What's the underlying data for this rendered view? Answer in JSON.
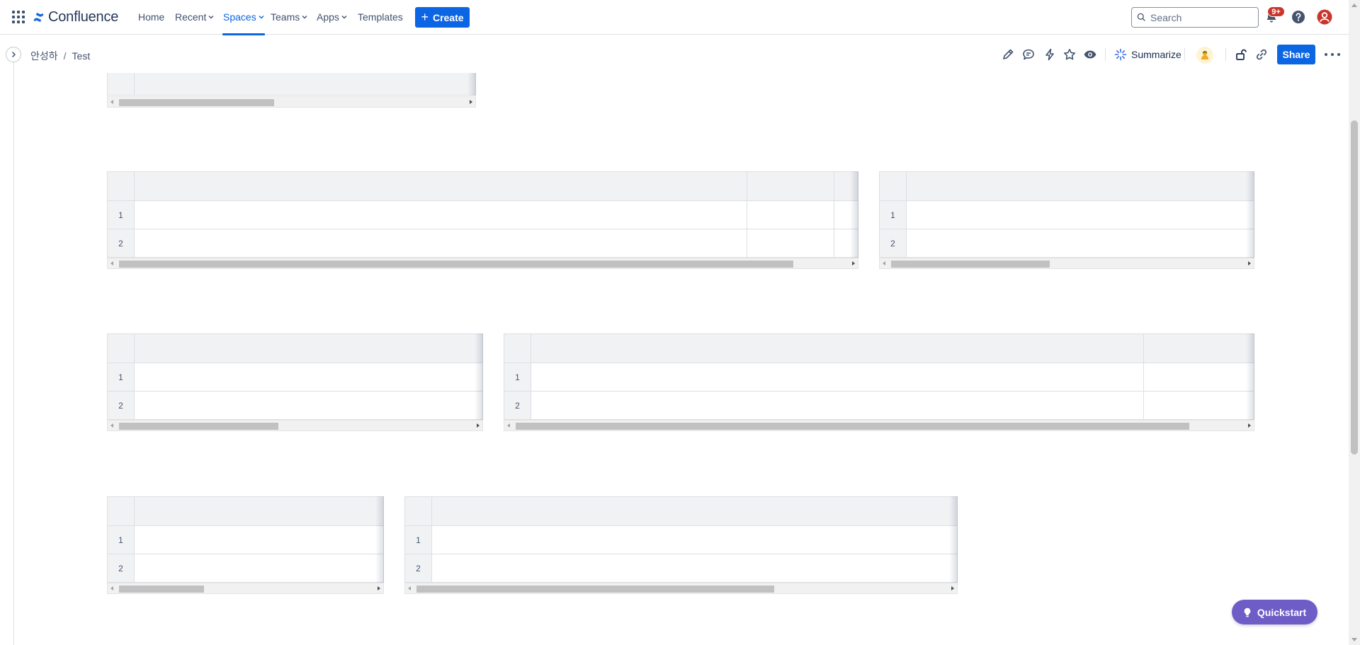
{
  "app": {
    "name": "Confluence"
  },
  "nav": {
    "items": [
      {
        "label": "Home",
        "dropdown": false,
        "active": false
      },
      {
        "label": "Recent",
        "dropdown": true,
        "active": false
      },
      {
        "label": "Spaces",
        "dropdown": true,
        "active": true
      },
      {
        "label": "Teams",
        "dropdown": true,
        "active": false
      },
      {
        "label": "Apps",
        "dropdown": true,
        "active": false
      },
      {
        "label": "Templates",
        "dropdown": false,
        "active": false
      }
    ],
    "create_label": "Create",
    "search_placeholder": "Search",
    "notification_badge": "9+"
  },
  "breadcrumb": {
    "space": "안성하",
    "separator": "/",
    "page": "Test"
  },
  "page_toolbar": {
    "summarize_label": "Summarize",
    "share_label": "Share"
  },
  "tables": [
    {
      "name": "table-1",
      "row_numbers": []
    },
    {
      "name": "table-2",
      "row_numbers": [
        "1",
        "2"
      ]
    },
    {
      "name": "table-3",
      "row_numbers": [
        "1",
        "2"
      ]
    },
    {
      "name": "table-4",
      "row_numbers": [
        "1",
        "2"
      ]
    },
    {
      "name": "table-5",
      "row_numbers": [
        "1",
        "2"
      ]
    },
    {
      "name": "table-6",
      "row_numbers": [
        "1",
        "2"
      ]
    },
    {
      "name": "table-7",
      "row_numbers": [
        "1",
        "2"
      ]
    }
  ],
  "quickstart_label": "Quickstart",
  "colors": {
    "brand_blue": "#0c66e4",
    "quickstart_purple": "#6e5dc6",
    "badge_red": "#c9372c",
    "avatar_red": "#c9372c"
  },
  "icons": [
    "app-switcher-icon",
    "confluence-logo-icon",
    "search-icon",
    "notification-icon",
    "help-icon",
    "profile-icon",
    "edit-icon",
    "comment-icon",
    "automation-icon",
    "star-icon",
    "watch-icon",
    "ai-sparkle-icon",
    "restrictions-icon",
    "copy-link-icon",
    "more-icon",
    "lightbulb-icon"
  ]
}
